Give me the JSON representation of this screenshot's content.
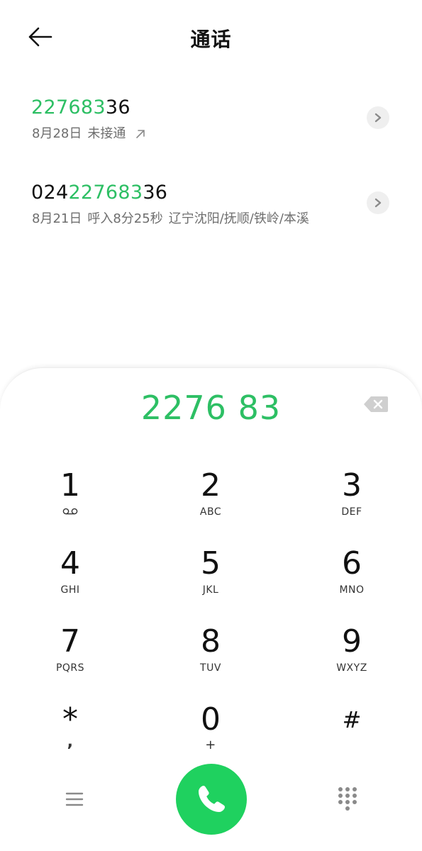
{
  "header": {
    "title": "通话"
  },
  "call_log": [
    {
      "number_highlight": "227683",
      "number_rest": "36",
      "date": "8月28日",
      "status": "未接通",
      "direction_icon": "outgoing-arrow-icon"
    },
    {
      "number_prefix": "024",
      "number_highlight": "227683",
      "number_rest": "36",
      "date": "8月21日",
      "status": "呼入8分25秒",
      "location": "辽宁沈阳/抚顺/铁岭/本溪"
    }
  ],
  "dialer": {
    "display": "2276 83",
    "keys": [
      {
        "digit": "1",
        "letters": ""
      },
      {
        "digit": "2",
        "letters": "ABC"
      },
      {
        "digit": "3",
        "letters": "DEF"
      },
      {
        "digit": "4",
        "letters": "GHI"
      },
      {
        "digit": "5",
        "letters": "JKL"
      },
      {
        "digit": "6",
        "letters": "MNO"
      },
      {
        "digit": "7",
        "letters": "PQRS"
      },
      {
        "digit": "8",
        "letters": "TUV"
      },
      {
        "digit": "9",
        "letters": "WXYZ"
      },
      {
        "digit": "*",
        "letters": ","
      },
      {
        "digit": "0",
        "letters": "+"
      },
      {
        "digit": "#",
        "letters": ""
      }
    ]
  },
  "colors": {
    "accent": "#2dbf64",
    "call_button": "#1fd15f"
  },
  "icons": [
    "back-arrow-icon",
    "chevron-right-icon",
    "backspace-icon",
    "voicemail-icon",
    "menu-icon",
    "phone-icon",
    "dialpad-icon"
  ]
}
